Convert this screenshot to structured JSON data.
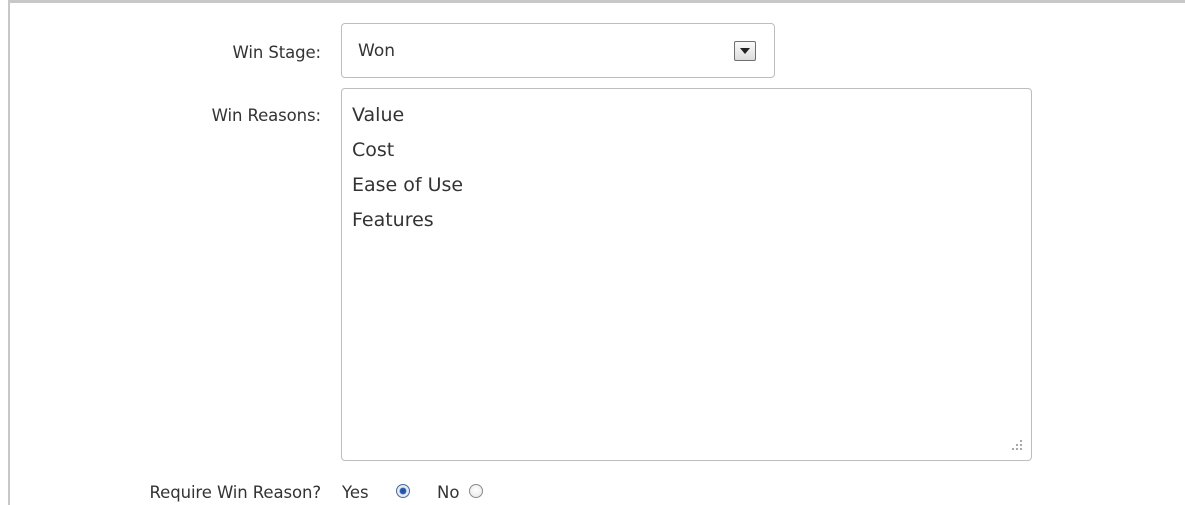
{
  "form": {
    "win_stage": {
      "label": "Win Stage:",
      "value": "Won"
    },
    "win_reasons": {
      "label": "Win Reasons:",
      "lines": [
        "Value",
        "Cost",
        "Ease of Use",
        "Features"
      ]
    },
    "require_win_reason": {
      "label": "Require Win Reason?",
      "options": [
        "Yes",
        "No"
      ],
      "selected": "Yes"
    }
  },
  "colors": {
    "border": "#bdbdbd",
    "text": "#333333",
    "radio_selected": "#1b4a8c"
  },
  "icons": {
    "select_arrow": "chevron-down-icon",
    "resize_grip": "resize-grip-icon"
  }
}
